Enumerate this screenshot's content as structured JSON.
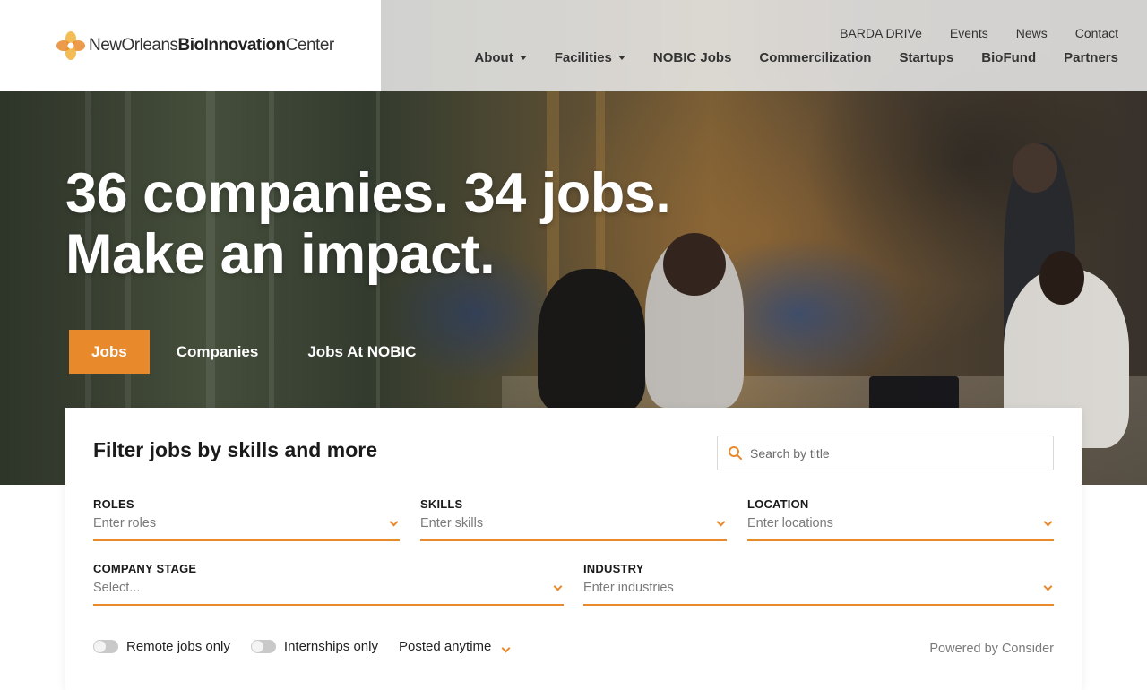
{
  "header": {
    "logo": {
      "part1": "NewOrleans",
      "part2": "BioInnovation",
      "part3": "Center"
    },
    "utility_nav": [
      "BARDA DRIVe",
      "Events",
      "News",
      "Contact"
    ],
    "main_nav": [
      {
        "label": "About",
        "has_dropdown": true
      },
      {
        "label": "Facilities",
        "has_dropdown": true
      },
      {
        "label": "NOBIC Jobs",
        "has_dropdown": false
      },
      {
        "label": "Commercilization",
        "has_dropdown": false
      },
      {
        "label": "Startups",
        "has_dropdown": false
      },
      {
        "label": "BioFund",
        "has_dropdown": false
      },
      {
        "label": "Partners",
        "has_dropdown": false
      }
    ]
  },
  "hero": {
    "headline_line1": "36 companies. 34 jobs.",
    "headline_line2": "Make an impact.",
    "tabs": [
      {
        "label": "Jobs",
        "active": true
      },
      {
        "label": "Companies",
        "active": false
      },
      {
        "label": "Jobs At NOBIC",
        "active": false
      }
    ]
  },
  "filter": {
    "title": "Filter jobs by skills and more",
    "search_placeholder": "Search by title",
    "fields": {
      "roles": {
        "label": "ROLES",
        "placeholder": "Enter roles"
      },
      "skills": {
        "label": "SKILLS",
        "placeholder": "Enter skills"
      },
      "location": {
        "label": "LOCATION",
        "placeholder": "Enter locations"
      },
      "company_stage": {
        "label": "COMPANY STAGE",
        "placeholder": "Select..."
      },
      "industry": {
        "label": "INDUSTRY",
        "placeholder": "Enter industries"
      }
    },
    "remote_label": "Remote jobs only",
    "internships_label": "Internships only",
    "posted_label": "Posted anytime",
    "powered_by": "Powered by Consider"
  },
  "colors": {
    "accent": "#e8892b",
    "header_glass": "#ebebeb",
    "text_dark": "#1a1a1a"
  },
  "icons": [
    "logo-flower-icon",
    "caret-down-icon",
    "search-icon",
    "chevron-down-icon"
  ]
}
